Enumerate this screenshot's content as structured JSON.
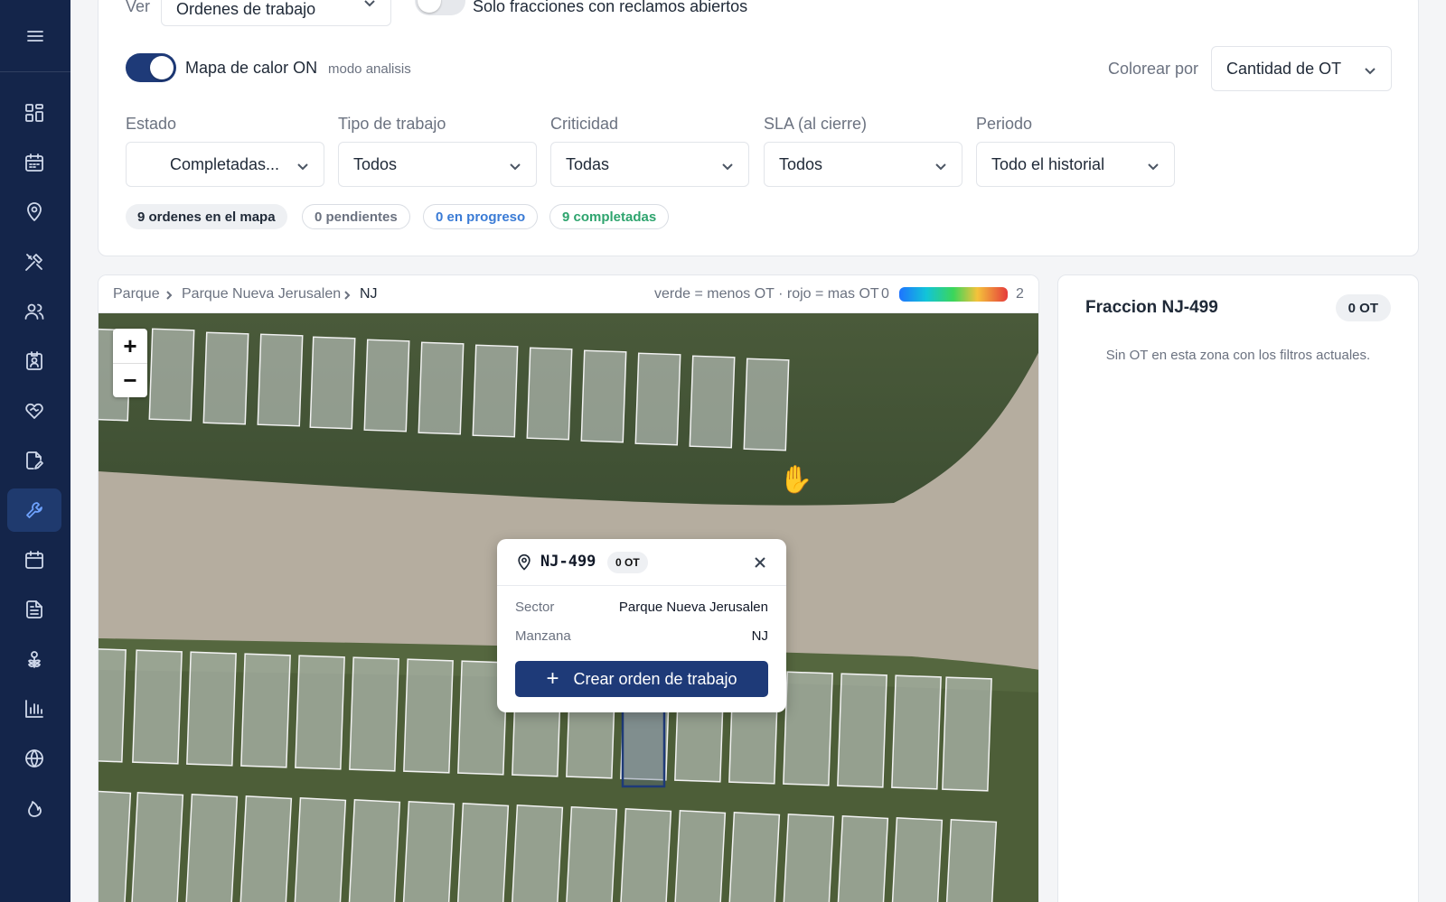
{
  "sidebar": {
    "menu_icon": "menu-icon",
    "items": [
      {
        "icon": "dashboard-icon"
      },
      {
        "icon": "calendar-icon"
      },
      {
        "icon": "map-pin-icon"
      },
      {
        "icon": "tools-icon"
      },
      {
        "icon": "users-icon"
      },
      {
        "icon": "badge-icon"
      },
      {
        "icon": "heart-handshake-icon"
      },
      {
        "icon": "document-edit-icon"
      },
      {
        "icon": "wrench-icon",
        "active": true
      },
      {
        "icon": "calendar-alt-icon"
      },
      {
        "icon": "file-text-icon"
      },
      {
        "icon": "flower-icon"
      },
      {
        "icon": "bar-chart-icon"
      },
      {
        "icon": "globe-icon"
      },
      {
        "icon": "flame-icon"
      }
    ]
  },
  "filters": {
    "ver_label": "Ver",
    "ver_value": "Ordenes de trabajo",
    "solo_label": "Solo fracciones con reclamos abiertos",
    "heatmap_label": "Mapa de calor ON",
    "heatmap_mode": "modo analisis",
    "colorear_label": "Colorear por",
    "colorear_value": "Cantidad de OT",
    "estado_label": "Estado",
    "estado_value": "Completadas...",
    "tipo_label": "Tipo de trabajo",
    "tipo_value": "Todos",
    "criticidad_label": "Criticidad",
    "criticidad_value": "Todas",
    "sla_label": "SLA (al cierre)",
    "sla_value": "Todos",
    "periodo_label": "Periodo",
    "periodo_value": "Todo el historial"
  },
  "summary": {
    "total": "9 ordenes en el mapa",
    "pendientes": "0 pendientes",
    "progreso": "0 en progreso",
    "completadas": "9 completadas"
  },
  "map": {
    "breadcrumb": [
      "Parque",
      "Parque Nueva Jerusalen",
      "NJ"
    ],
    "legend_text": "verde = menos OT · rojo = mas OT",
    "legend_min": "0",
    "legend_max": "2",
    "zoom_in": "+",
    "zoom_out": "−"
  },
  "popup": {
    "title": "NJ-499",
    "badge": "0 OT",
    "rows": [
      {
        "key": "Sector",
        "value": "Parque Nueva Jerusalen"
      },
      {
        "key": "Manzana",
        "value": "NJ"
      }
    ],
    "button_label": "Crear orden de trabajo"
  },
  "side_panel": {
    "title": "Fraccion NJ-499",
    "badge": "0 OT",
    "empty_text": "Sin OT en esta zona con los filtros actuales."
  },
  "colors": {
    "sidebar_bg": "#14254a",
    "primary": "#1e3a78",
    "accent_blue": "#3a7bd5",
    "accent_green": "#2ea46e"
  }
}
